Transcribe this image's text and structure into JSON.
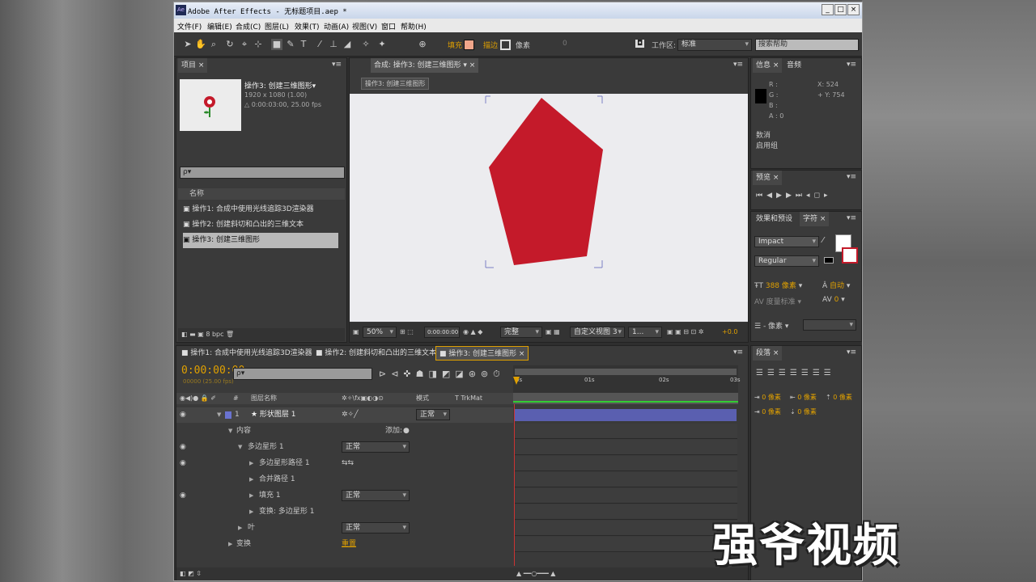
{
  "window": {
    "title": "Adobe After Effects - 无标题项目.aep *",
    "icon": "Ae",
    "controls": [
      "_",
      "□",
      "×"
    ]
  },
  "menu": [
    "文件(F)",
    "编辑(E)",
    "合成(C)",
    "图层(L)",
    "效果(T)",
    "动画(A)",
    "视图(V)",
    "窗口",
    "帮助(H)"
  ],
  "toolbar": {
    "fill_label": "填充",
    "stroke_label": "描边",
    "pixel_label": "像素",
    "stroke_value": "0",
    "workspace_label": "工作区:",
    "workspace_value": "标准",
    "search_placeholder": "搜索帮助"
  },
  "project": {
    "tab": "项目",
    "comp_name": "操作3: 创建三维图形▾",
    "comp_size": "1920 x 1080 (1.00)",
    "comp_duration": "△ 0:00:03:00, 25.00 fps",
    "search_prefix": "ρ▾",
    "col_name": "名称",
    "items": [
      "操作1: 合成中使用光线追踪3D渲染器",
      "操作2: 创建斜切和凸出的三维文本",
      "操作3: 创建三维图形"
    ],
    "bpc": "8 bpc"
  },
  "composition": {
    "tab": "合成: 操作3: 创建三维图形",
    "breadcrumb": "操作3: 创建三维图形",
    "zoom": "50%",
    "timecode": "0:00:00:00",
    "quality": "完整",
    "view": "自定义视图 3",
    "views": "1...",
    "exposure": "+0.0"
  },
  "info": {
    "tab1": "信息",
    "tab2": "音频",
    "r": "R :",
    "g": "G :",
    "b": "B :",
    "a": "A : 0",
    "x": "X: 524",
    "y": "+ Y: 754",
    "line1": "数消",
    "line2": "启用组"
  },
  "preview": {
    "tab": "预览"
  },
  "character": {
    "tab1": "效果和预设",
    "tab2": "字符",
    "font": "Impact",
    "style": "Regular",
    "size": "388 像素",
    "leading": "自动",
    "tracking_label": "度量标准",
    "tracking": "0",
    "stroke": "- 像素"
  },
  "paragraph": {
    "tab": "段落",
    "v1": "0 像素",
    "v2": "0 像素",
    "v3": "0 像素",
    "v4": "0 像素",
    "v5": "0 像素"
  },
  "timeline": {
    "tabs": [
      "操作1: 合成中使用光线追踪3D渲染器",
      "操作2: 创建斜切和凸出的三维文本",
      "操作3: 创建三维图形"
    ],
    "timecode": "0:00:00:00",
    "timecode_sub": "00000 (25.00 fps)",
    "search_prefix": "ρ▾",
    "col_num": "#",
    "col_layer": "图层名称",
    "col_mode": "模式",
    "col_trkmat": "T  TrkMat",
    "ruler": [
      "0s",
      "01s",
      "02s",
      "03s"
    ],
    "layer": {
      "num": "1",
      "name": "★ 形状图层 1",
      "mode": "正常"
    },
    "rows": [
      {
        "label": "内容",
        "indent": 1,
        "extra": "添加:"
      },
      {
        "label": "多边星形 1",
        "indent": 2,
        "mode": "正常"
      },
      {
        "label": "多边星形路径 1",
        "indent": 3
      },
      {
        "label": "合并路径 1",
        "indent": 3
      },
      {
        "label": "填充 1",
        "indent": 3,
        "mode": "正常"
      },
      {
        "label": "变换: 多边星形 1",
        "indent": 3
      },
      {
        "label": "叶",
        "indent": 2,
        "mode": "正常"
      },
      {
        "label": "变换",
        "indent": 1,
        "reset": "重置"
      }
    ]
  },
  "watermark": "强爷视频",
  "colors": {
    "star": "#c41a2a",
    "fill_swatch": "#f0a58a",
    "accent": "#e0a000",
    "layer_bar": "#5a5fb0"
  }
}
